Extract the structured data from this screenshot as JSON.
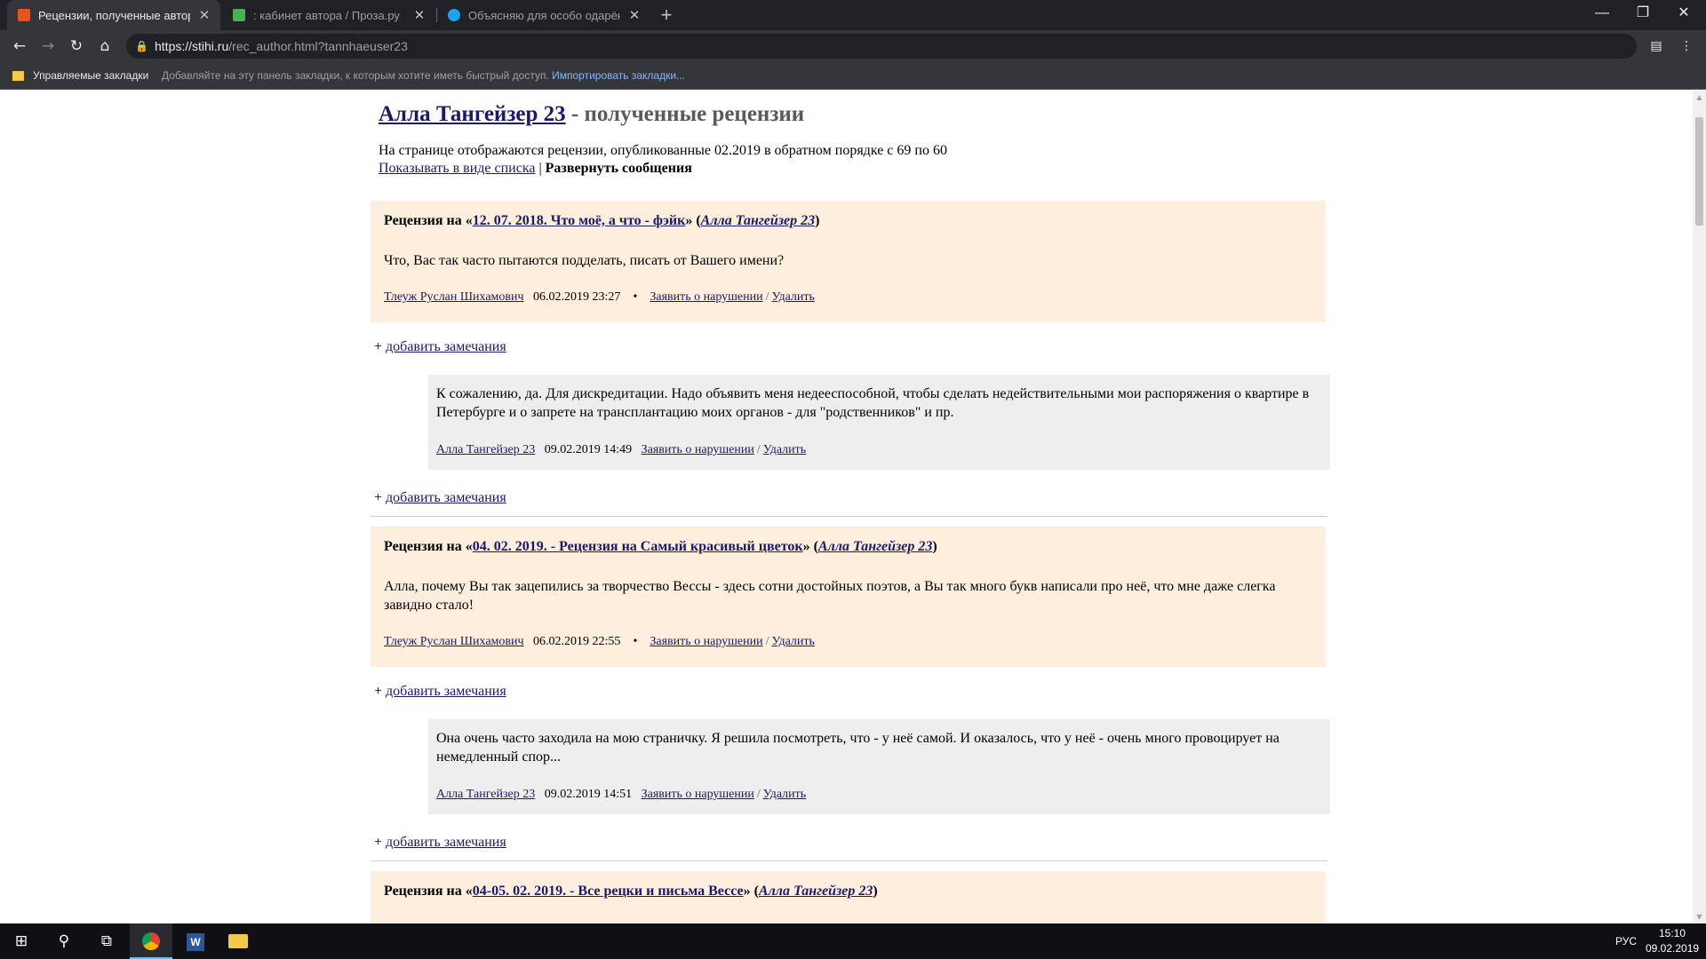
{
  "browser": {
    "tabs": [
      {
        "title": "Рецензии, полученные автором",
        "favicon_color": "#e8541e",
        "active": true
      },
      {
        "title": ": кабинет автора / Проза.ру",
        "favicon_color": "#4caf50",
        "active": false
      },
      {
        "title": "Объясняю для особо одарённых",
        "favicon_color": "#1da1f2",
        "active": false
      }
    ],
    "new_tab": "+",
    "url_host": "https://stihi.ru",
    "url_path": "/rec_author.html?tannhaeuser23",
    "bookmarks": {
      "managed": "Управляемые закладки",
      "hint": "Добавляйте на эту панель закладки, к которым хотите иметь быстрый доступ.",
      "import": "Импортировать закладки..."
    }
  },
  "page": {
    "author_link": "Алла Тангейзер 23",
    "title_suffix": " - полученные рецензии",
    "intro": "На странице отображаются рецензии, опубликованные 02.2019 в обратном порядке с 69 по 60",
    "show_as_list": "Показывать в виде списка",
    "separator": " | ",
    "expand_messages": "Развернуть сообщения",
    "review_prefix": "Рецензия на «",
    "review_mid": "» (",
    "review_suffix": ")",
    "add_remark_plus": "+ ",
    "add_remark": "добавить замечания",
    "report": "Заявить о нарушении",
    "slash": "/",
    "delete": "Удалить",
    "dot": "•",
    "reviews": [
      {
        "work": "12. 07. 2018. Что моё, а что - фэйк",
        "work_author": "Алла Тангейзер 23",
        "text": "Что, Вас так часто пытаются подделать, писать от Вашего имени?",
        "reviewer": "Тлеуж Руслан Шихамович",
        "date": "06.02.2019 23:27",
        "reply": {
          "text": "К сожалению, да. Для дискредитации. Надо объявить меня недееспособной, чтобы сделать недействительными мои распоряжения о квартире в Петербурге и о запрете на трансплантацию моих органов - для \"родственников\" и пр.",
          "author": "Алла Тангейзер 23",
          "date": "09.02.2019 14:49"
        }
      },
      {
        "work": "04. 02. 2019. - Рецензия на Самый красивый цветок",
        "work_author": "Алла Тангейзер 23",
        "text": "Алла, почему Вы так зацепились за творчество Вессы - здесь сотни достойных поэтов, а Вы так много букв написали про неё, что мне даже слегка завидно стало!",
        "reviewer": "Тлеуж Руслан Шихамович",
        "date": "06.02.2019 22:55",
        "reply": {
          "text": "Она очень часто заходила на мою страничку. Я решила посмотреть, что - у неё самой. И оказалось, что у неё - очень много провоцирует на немедленный спор...",
          "author": "Алла Тангейзер 23",
          "date": "09.02.2019 14:51"
        }
      },
      {
        "work": "04-05. 02. 2019. - Все рецки и письма Вессе",
        "work_author": "Алла Тангейзер 23"
      }
    ]
  },
  "taskbar": {
    "lang": "РУС",
    "time": "15:10",
    "date": "09.02.2019"
  }
}
